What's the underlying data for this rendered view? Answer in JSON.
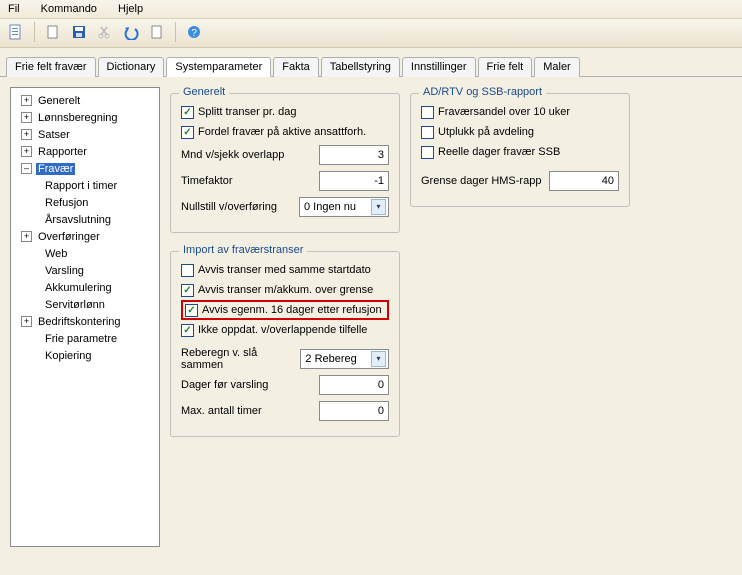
{
  "menu": {
    "file": "Fil",
    "kommando": "Kommando",
    "help": "Hjelp"
  },
  "toolbar_icons": {
    "page": "page-icon",
    "new": "new-icon",
    "save": "save-icon",
    "cut": "cut-icon",
    "undo": "undo-icon",
    "doc": "doc-icon",
    "help": "help-icon"
  },
  "tabs": {
    "frie_felt_fravaer": "Frie felt fravær",
    "dictionary": "Dictionary",
    "systemparameter": "Systemparameter",
    "fakta": "Fakta",
    "tabellstyring": "Tabellstyring",
    "innstillinger": "Innstillinger",
    "frie_felt": "Frie felt",
    "maler": "Maler"
  },
  "tree": {
    "generelt": "Generelt",
    "lonnsberegning": "Lønnsberegning",
    "satser": "Satser",
    "rapporter": "Rapporter",
    "fravaer": "Fravær",
    "rapport_i_timer": "Rapport i timer",
    "refusjon": "Refusjon",
    "arsavslutning": "Årsavslutning",
    "overforinger": "Overføringer",
    "web": "Web",
    "varsling": "Varsling",
    "akkumulering": "Akkumulering",
    "servitorlonn": "Servitørlønn",
    "bedriftskontering": "Bedriftskontering",
    "frie_parametre": "Frie parametre",
    "kopiering": "Kopiering"
  },
  "grp_generelt": {
    "legend": "Generelt",
    "splitt": "Splitt transer pr. dag",
    "fordel": "Fordel fravær på aktive ansattforh.",
    "mnd_label": "Mnd v/sjekk overlapp",
    "mnd_val": "3",
    "timefaktor_label": "Timefaktor",
    "timefaktor_val": "-1",
    "nullstill_label": "Nullstill v/overføring",
    "nullstill_val": "0 Ingen nu"
  },
  "grp_import": {
    "legend": "Import av fraværstranser",
    "avvis_samme": "Avvis transer med samme startdato",
    "avvis_akkum": "Avvis transer m/akkum. over grense",
    "avvis_egenm": "Avvis egenm. 16 dager etter refusjon",
    "ikke_oppdat": "Ikke oppdat. v/overlappende tilfelle",
    "reberegn_label": "Reberegn v. slå sammen",
    "reberegn_val": "2 Rebereg",
    "dager_label": "Dager før varsling",
    "dager_val": "0",
    "max_label": "Max. antall timer",
    "max_val": "0"
  },
  "grp_adrtv": {
    "legend": "AD/RTV og SSB-rapport",
    "fravaersandel": "Fraværsandel  over 10 uker",
    "utplukk": "Utplukk på avdeling",
    "reelle": "Reelle dager fravær SSB",
    "grense_label": "Grense dager HMS-rapp",
    "grense_val": "40"
  }
}
